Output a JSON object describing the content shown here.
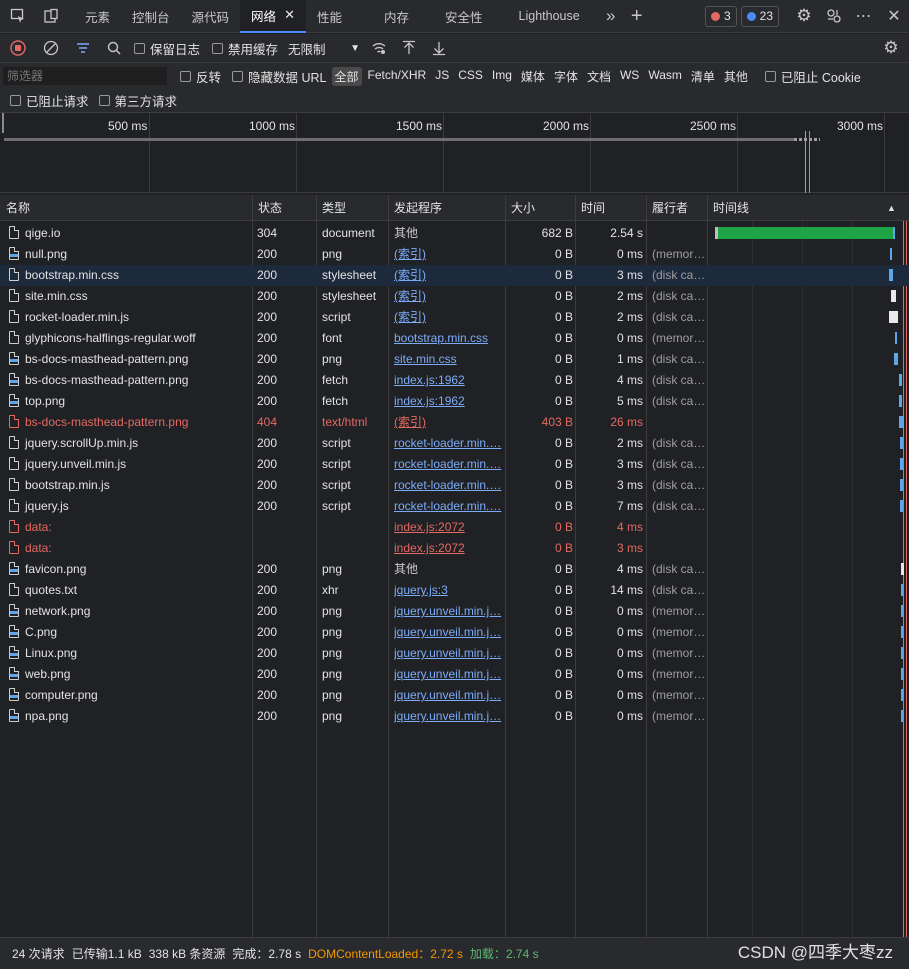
{
  "tabs": [
    {
      "label": "元素"
    },
    {
      "label": "控制台"
    },
    {
      "label": "源代码"
    },
    {
      "label": "网络",
      "close": "✕"
    },
    {
      "label": "性能"
    },
    {
      "label": "内存"
    },
    {
      "label": "安全性"
    },
    {
      "label": "Lighthouse"
    }
  ],
  "badges": {
    "errors": "3",
    "messages": "23"
  },
  "toolbar": {
    "preserve_log": "保留日志",
    "disable_cache": "禁用缓存",
    "throttle": "无限制"
  },
  "filter": {
    "placeholder": "筛选器",
    "invert": "反转",
    "hide_data_url": "隐藏数据 URL",
    "types": [
      "全部",
      "Fetch/XHR",
      "JS",
      "CSS",
      "Img",
      "媒体",
      "字体",
      "文档",
      "WS",
      "Wasm",
      "清单",
      "其他"
    ],
    "blocked_cookies": "已阻止 Cookie",
    "blocked_requests": "已阻止请求",
    "third_party": "第三方请求"
  },
  "overview": {
    "ticks": [
      "500 ms",
      "1000 ms",
      "1500 ms",
      "2000 ms",
      "2500 ms",
      "3000 ms"
    ]
  },
  "columns": {
    "name": "名称",
    "status": "状态",
    "type": "类型",
    "initiator": "发起程序",
    "size": "大小",
    "time": "时间",
    "fulfilled": "履行者",
    "waterfall": "时间线"
  },
  "rows": [
    {
      "name": "qige.io",
      "status": "304",
      "type": "document",
      "initiator": "其他",
      "size": "682 B",
      "time": "2.54 s",
      "fulfilled": ""
    },
    {
      "name": "null.png",
      "status": "200",
      "type": "png",
      "initiator": "(索引)",
      "size": "0 B",
      "time": "0 ms",
      "fulfilled": "(memor…"
    },
    {
      "name": "bootstrap.min.css",
      "status": "200",
      "type": "stylesheet",
      "initiator": "(索引)",
      "size": "0 B",
      "time": "3 ms",
      "fulfilled": "(disk ca…"
    },
    {
      "name": "site.min.css",
      "status": "200",
      "type": "stylesheet",
      "initiator": "(索引)",
      "size": "0 B",
      "time": "2 ms",
      "fulfilled": "(disk ca…"
    },
    {
      "name": "rocket-loader.min.js",
      "status": "200",
      "type": "script",
      "initiator": "(索引)",
      "size": "0 B",
      "time": "2 ms",
      "fulfilled": "(disk ca…"
    },
    {
      "name": "glyphicons-halflings-regular.woff",
      "status": "200",
      "type": "font",
      "initiator": "bootstrap.min.css",
      "size": "0 B",
      "time": "0 ms",
      "fulfilled": "(memor…"
    },
    {
      "name": "bs-docs-masthead-pattern.png",
      "status": "200",
      "type": "png",
      "initiator": "site.min.css",
      "size": "0 B",
      "time": "1 ms",
      "fulfilled": "(disk ca…"
    },
    {
      "name": "bs-docs-masthead-pattern.png",
      "status": "200",
      "type": "fetch",
      "initiator": "index.js:1962",
      "size": "0 B",
      "time": "4 ms",
      "fulfilled": "(disk ca…"
    },
    {
      "name": "top.png",
      "status": "200",
      "type": "fetch",
      "initiator": "index.js:1962",
      "size": "0 B",
      "time": "5 ms",
      "fulfilled": "(disk ca…"
    },
    {
      "name": "bs-docs-masthead-pattern.png",
      "status": "404",
      "type": "text/html",
      "initiator": "(索引)",
      "size": "403 B",
      "time": "26 ms",
      "fulfilled": ""
    },
    {
      "name": "jquery.scrollUp.min.js",
      "status": "200",
      "type": "script",
      "initiator": "rocket-loader.min.…",
      "size": "0 B",
      "time": "2 ms",
      "fulfilled": "(disk ca…"
    },
    {
      "name": "jquery.unveil.min.js",
      "status": "200",
      "type": "script",
      "initiator": "rocket-loader.min.…",
      "size": "0 B",
      "time": "3 ms",
      "fulfilled": "(disk ca…"
    },
    {
      "name": "bootstrap.min.js",
      "status": "200",
      "type": "script",
      "initiator": "rocket-loader.min.…",
      "size": "0 B",
      "time": "3 ms",
      "fulfilled": "(disk ca…"
    },
    {
      "name": "jquery.js",
      "status": "200",
      "type": "script",
      "initiator": "rocket-loader.min.…",
      "size": "0 B",
      "time": "7 ms",
      "fulfilled": "(disk ca…"
    },
    {
      "name": "data:",
      "status": "",
      "type": "",
      "initiator": "index.js:2072",
      "size": "0 B",
      "time": "4 ms",
      "fulfilled": ""
    },
    {
      "name": "data:",
      "status": "",
      "type": "",
      "initiator": "index.js:2072",
      "size": "0 B",
      "time": "3 ms",
      "fulfilled": ""
    },
    {
      "name": "favicon.png",
      "status": "200",
      "type": "png",
      "initiator": "其他",
      "size": "0 B",
      "time": "4 ms",
      "fulfilled": "(disk ca…"
    },
    {
      "name": "quotes.txt",
      "status": "200",
      "type": "xhr",
      "initiator": "jquery.js:3",
      "size": "0 B",
      "time": "14 ms",
      "fulfilled": "(disk ca…"
    },
    {
      "name": "network.png",
      "status": "200",
      "type": "png",
      "initiator": "jquery.unveil.min.j…",
      "size": "0 B",
      "time": "0 ms",
      "fulfilled": "(memor…"
    },
    {
      "name": "C.png",
      "status": "200",
      "type": "png",
      "initiator": "jquery.unveil.min.j…",
      "size": "0 B",
      "time": "0 ms",
      "fulfilled": "(memor…"
    },
    {
      "name": "Linux.png",
      "status": "200",
      "type": "png",
      "initiator": "jquery.unveil.min.j…",
      "size": "0 B",
      "time": "0 ms",
      "fulfilled": "(memor…"
    },
    {
      "name": "web.png",
      "status": "200",
      "type": "png",
      "initiator": "jquery.unveil.min.j…",
      "size": "0 B",
      "time": "0 ms",
      "fulfilled": "(memor…"
    },
    {
      "name": "computer.png",
      "status": "200",
      "type": "png",
      "initiator": "jquery.unveil.min.j…",
      "size": "0 B",
      "time": "0 ms",
      "fulfilled": "(memor…"
    },
    {
      "name": "npa.png",
      "status": "200",
      "type": "png",
      "initiator": "jquery.unveil.min.j…",
      "size": "0 B",
      "time": "0 ms",
      "fulfilled": "(memor…"
    }
  ],
  "status": {
    "requests": "24 次请求",
    "transferred": "已传输1.1 kB",
    "resources": "338 kB 条资源",
    "finish": "完成：2.78 s",
    "dcl": "DOMContentLoaded：2.72 s",
    "load": "加载：2.74 s"
  },
  "watermark": "CSDN @四季大枣zz",
  "colors": {
    "error": "#e46962",
    "link": "#7cacf8",
    "accent": "#4c8bf5",
    "load": "#5bb974",
    "dcl": "#f29900"
  }
}
